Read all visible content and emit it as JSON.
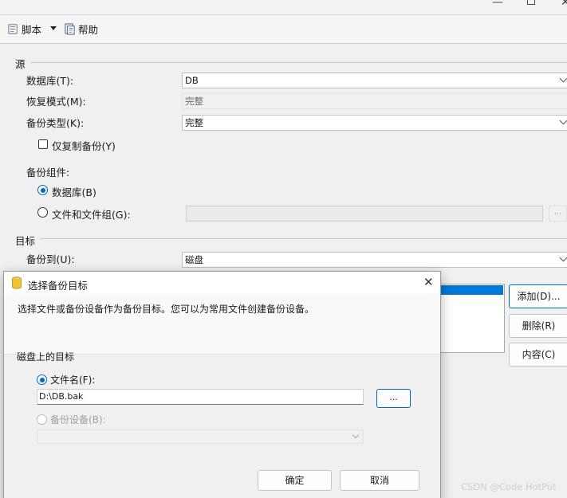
{
  "toolbar": {
    "script_label": "脚本",
    "help_label": "帮助"
  },
  "source": {
    "section_title": "源",
    "database_label": "数据库(T):",
    "database_value": "DB",
    "recovery_label": "恢复模式(M):",
    "recovery_value": "完整",
    "backup_type_label": "备份类型(K):",
    "backup_type_value": "完整",
    "copy_only_label": "仅复制备份(Y)"
  },
  "component": {
    "title": "备份组件:",
    "database_option": "数据库(B)",
    "files_option": "文件和文件组(G):",
    "files_browse": "..."
  },
  "destination": {
    "section_title": "目标",
    "backup_to_label": "备份到(U):",
    "backup_to_value": "磁盘",
    "add_button": "添加(D)...",
    "remove_button": "删除(R)",
    "contents_button": "内容(C)"
  },
  "dialog": {
    "title": "选择备份目标",
    "description": "选择文件或备份设备作为备份目标。您可以为常用文件创建备份设备。",
    "disk_dest_title": "磁盘上的目标",
    "filename_option": "文件名(F):",
    "filename_value": "D:\\DB.bak",
    "browse_button": "...",
    "device_option": "备份设备(B):",
    "ok_button": "确定",
    "cancel_button": "取消"
  },
  "watermark": "CSDN @Code HotPot",
  "colors": {
    "accent": "#0067c0",
    "selection": "#0078d7"
  }
}
